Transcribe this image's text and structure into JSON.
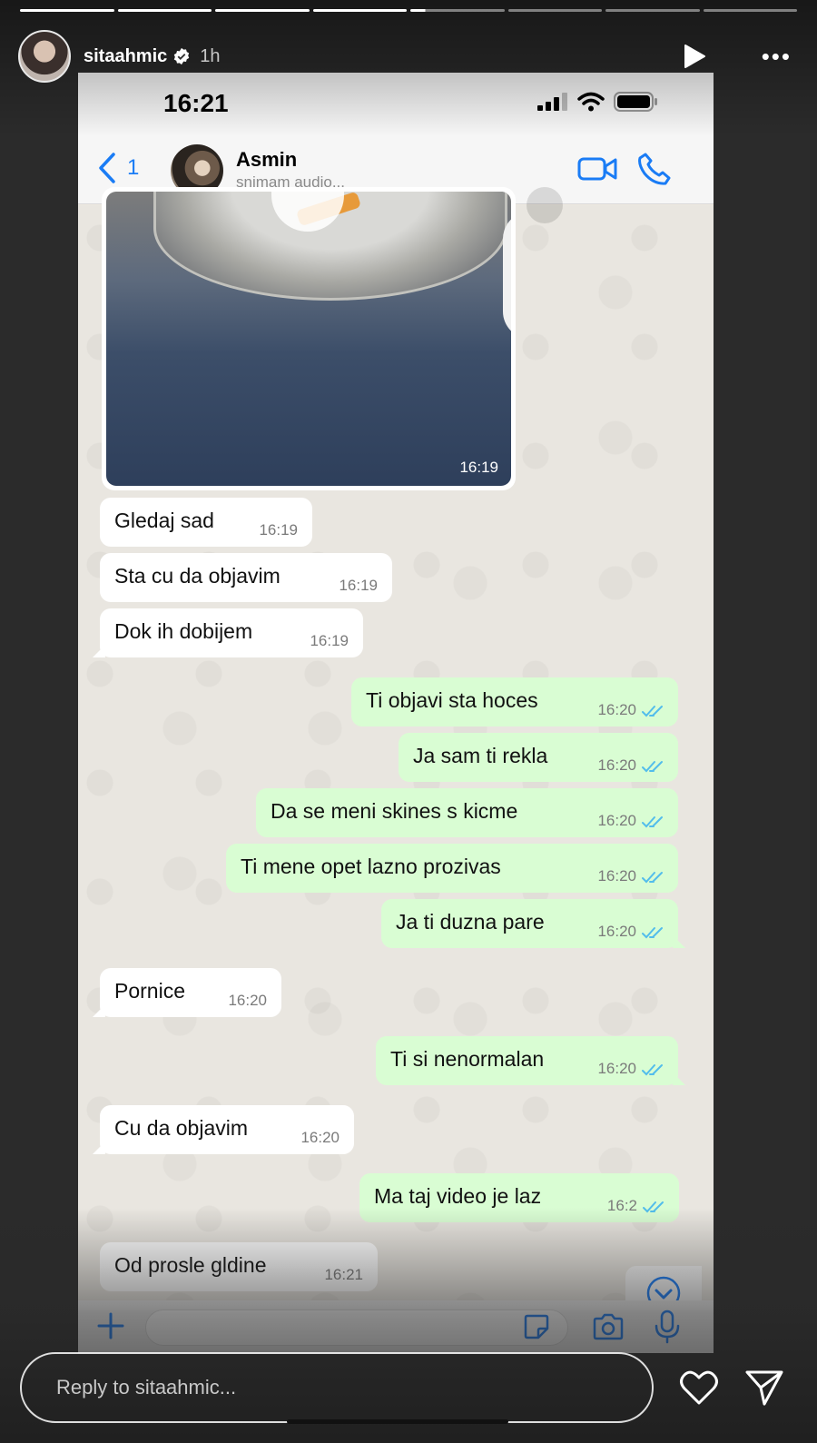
{
  "story": {
    "username": "sitaahmic",
    "posted_ago": "1h",
    "progress_segments": 8,
    "current_segment": 5,
    "current_segment_progress": 0.16,
    "reply_placeholder": "Reply to sitaahmic..."
  },
  "phone": {
    "status_time": "16:21",
    "back_count": "1",
    "contact_name": "Asmin",
    "contact_status": "snimam audio..."
  },
  "media": {
    "time": "16:19"
  },
  "messages": [
    {
      "dir": "in",
      "text": "Gledaj sad",
      "time": "16:19"
    },
    {
      "dir": "in",
      "text": "Sta cu da objavim",
      "time": "16:19"
    },
    {
      "dir": "in",
      "text": "Dok ih dobijem",
      "time": "16:19"
    },
    {
      "dir": "out",
      "text": "Ti objavi sta hoces",
      "time": "16:20"
    },
    {
      "dir": "out",
      "text": "Ja sam ti rekla",
      "time": "16:20"
    },
    {
      "dir": "out",
      "text": "Da se meni skines s kicme",
      "time": "16:20"
    },
    {
      "dir": "out",
      "text": "Ti mene opet lazno prozivas",
      "time": "16:20"
    },
    {
      "dir": "out",
      "text": "Ja ti duzna pare",
      "time": "16:20"
    },
    {
      "dir": "in",
      "text": "Pornice",
      "time": "16:20"
    },
    {
      "dir": "out",
      "text": "Ti si nenormalan",
      "time": "16:20"
    },
    {
      "dir": "in",
      "text": "Cu da objavim",
      "time": "16:20"
    },
    {
      "dir": "out",
      "text": "Ma taj video je laz",
      "time": "16:2"
    },
    {
      "dir": "in",
      "text": "Od prosle gldine",
      "time": "16:21"
    }
  ],
  "colors": {
    "incoming_bubble": "#ffffff",
    "outgoing_bubble": "#d9fdd3",
    "ios_blue": "#1a7cf5",
    "read_ticks": "#53bdeb"
  },
  "icons": [
    "verified-icon",
    "play-icon",
    "more-icon",
    "back-icon",
    "video-call-icon",
    "phone-call-icon",
    "chevron-down-icon",
    "plus-icon",
    "sticker-icon",
    "camera-icon",
    "mic-icon",
    "heart-icon",
    "send-icon"
  ]
}
